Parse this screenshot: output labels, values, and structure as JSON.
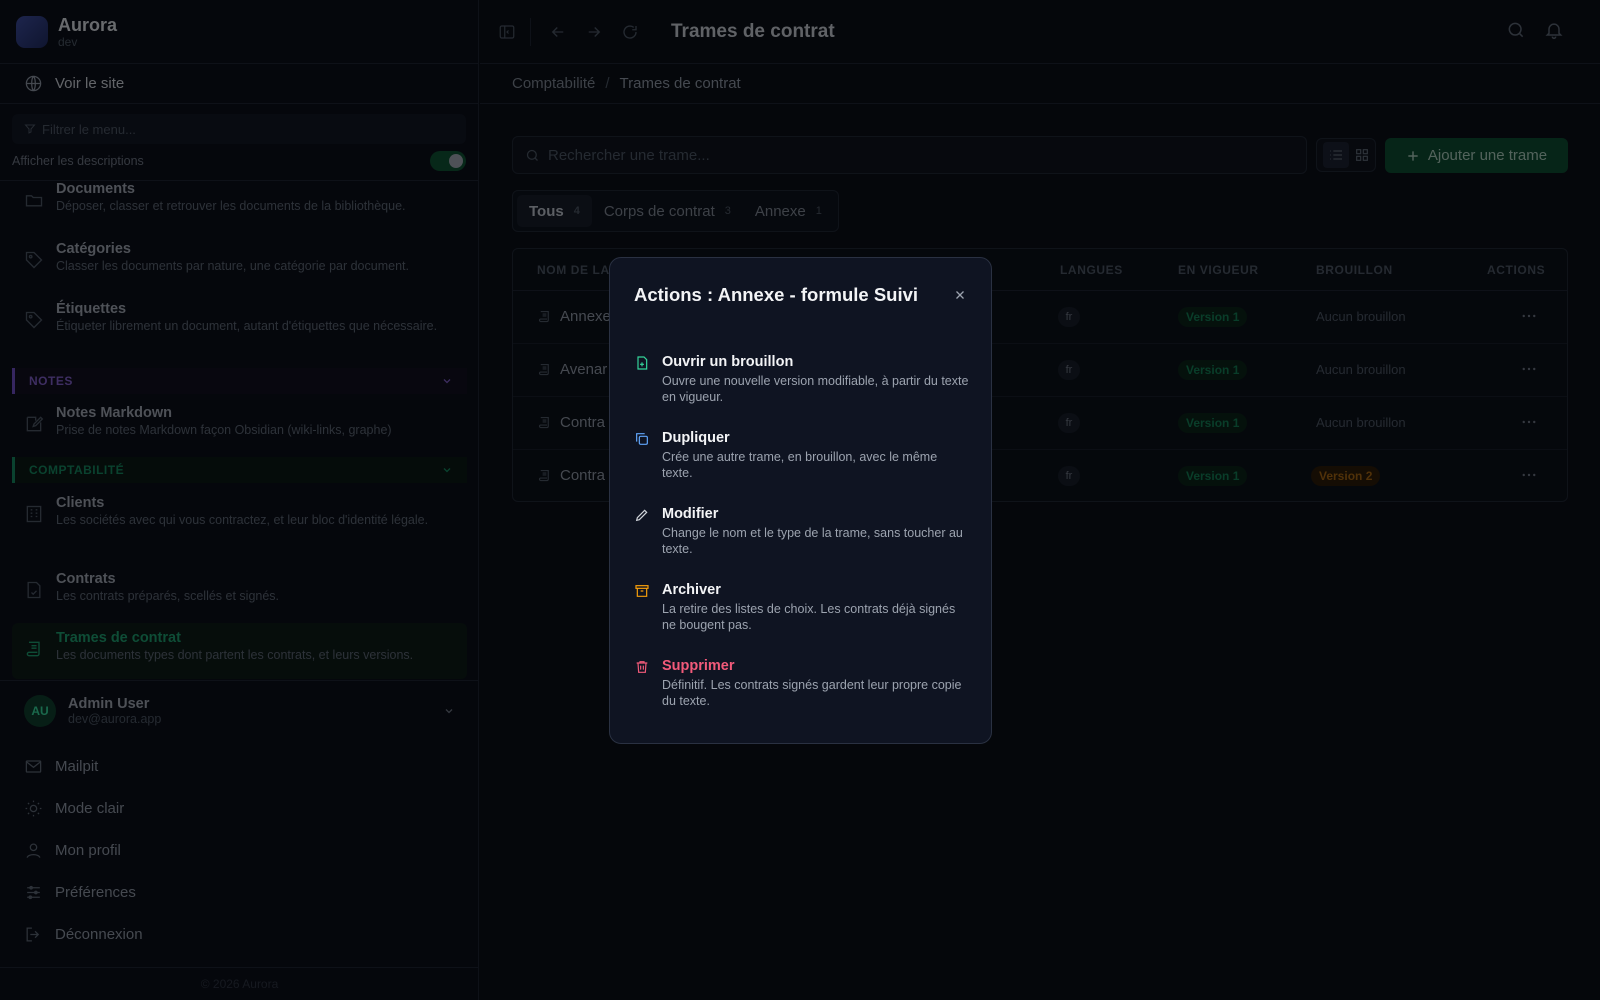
{
  "app": {
    "name": "Aurora",
    "env": "dev"
  },
  "sidebar": {
    "visit_label": "Voir le site",
    "filter_placeholder": "Filtrer le menu...",
    "show_descriptions": "Afficher les descriptions",
    "items": [
      {
        "title": "Documents",
        "desc": "Déposer, classer et retrouver les documents de la bibliothèque.",
        "icon": "folder-icon"
      },
      {
        "title": "Catégories",
        "desc": "Classer les documents par nature, une catégorie par document.",
        "icon": "tag-icon"
      },
      {
        "title": "Étiquettes",
        "desc": "Étiqueter librement un document, autant d'étiquettes que nécessaire.",
        "icon": "tags-icon"
      },
      {
        "title": "Notes Markdown",
        "desc": "Prise de notes Markdown façon Obsidian (wiki-links, graphe)",
        "icon": "note-edit-icon"
      },
      {
        "title": "Clients",
        "desc": "Les sociétés avec qui vous contractez, et leur bloc d'identité légale.",
        "icon": "building-icon"
      },
      {
        "title": "Contrats",
        "desc": "Les contrats préparés, scellés et signés.",
        "icon": "contract-icon"
      },
      {
        "title": "Trames de contrat",
        "desc": "Les documents types dont partent les contrats, et leurs versions.",
        "icon": "scroll-icon"
      }
    ],
    "sections": {
      "notes": "NOTES",
      "compta": "COMPTABILITÉ"
    },
    "user": {
      "initials": "AU",
      "name": "Admin User",
      "email": "dev@aurora.app"
    },
    "bottom": [
      "Mailpit",
      "Mode clair",
      "Mon profil",
      "Préférences",
      "Déconnexion"
    ],
    "footer": "© 2026 Aurora"
  },
  "header": {
    "title": "Trames de contrat"
  },
  "breadcrumb": {
    "parent": "Comptabilité",
    "current": "Trames de contrat"
  },
  "search": {
    "placeholder": "Rechercher une trame..."
  },
  "add_button": "Ajouter une trame",
  "tabs": [
    {
      "label": "Tous",
      "count": "4"
    },
    {
      "label": "Corps de contrat",
      "count": "3"
    },
    {
      "label": "Annexe",
      "count": "1"
    }
  ],
  "table": {
    "headers": {
      "name": "NOM DE LA",
      "langs": "LANGUES",
      "current": "EN VIGUEUR",
      "draft": "BROUILLON",
      "actions": "ACTIONS"
    },
    "rows": [
      {
        "name": "Annexe",
        "lang": "fr",
        "version": "Version 1",
        "draft": "Aucun brouillon"
      },
      {
        "name": "Avenar",
        "lang": "fr",
        "version": "Version 1",
        "draft": "Aucun brouillon"
      },
      {
        "name": "Contra",
        "lang": "fr",
        "version": "Version 1",
        "draft": "Aucun brouillon"
      },
      {
        "name": "Contra",
        "lang": "fr",
        "version": "Version 1",
        "draft": "Version 2"
      }
    ]
  },
  "modal": {
    "title": "Actions : Annexe - formule Suivi",
    "actions": [
      {
        "title": "Ouvrir un brouillon",
        "desc": "Ouvre une nouvelle version modifiable, à partir du texte en vigueur.",
        "color": "#34d399"
      },
      {
        "title": "Dupliquer",
        "desc": "Crée une autre trame, en brouillon, avec le même texte.",
        "color": "#60a5fa"
      },
      {
        "title": "Modifier",
        "desc": "Change le nom et le type de la trame, sans toucher au texte.",
        "color": "#d1d5db"
      },
      {
        "title": "Archiver",
        "desc": "La retire des listes de choix. Les contrats déjà signés ne bougent pas.",
        "color": "#f59e0b"
      },
      {
        "title": "Supprimer",
        "desc": "Définitif. Les contrats signés gardent leur propre copie du texte.",
        "color": "#f25a7a"
      }
    ]
  }
}
